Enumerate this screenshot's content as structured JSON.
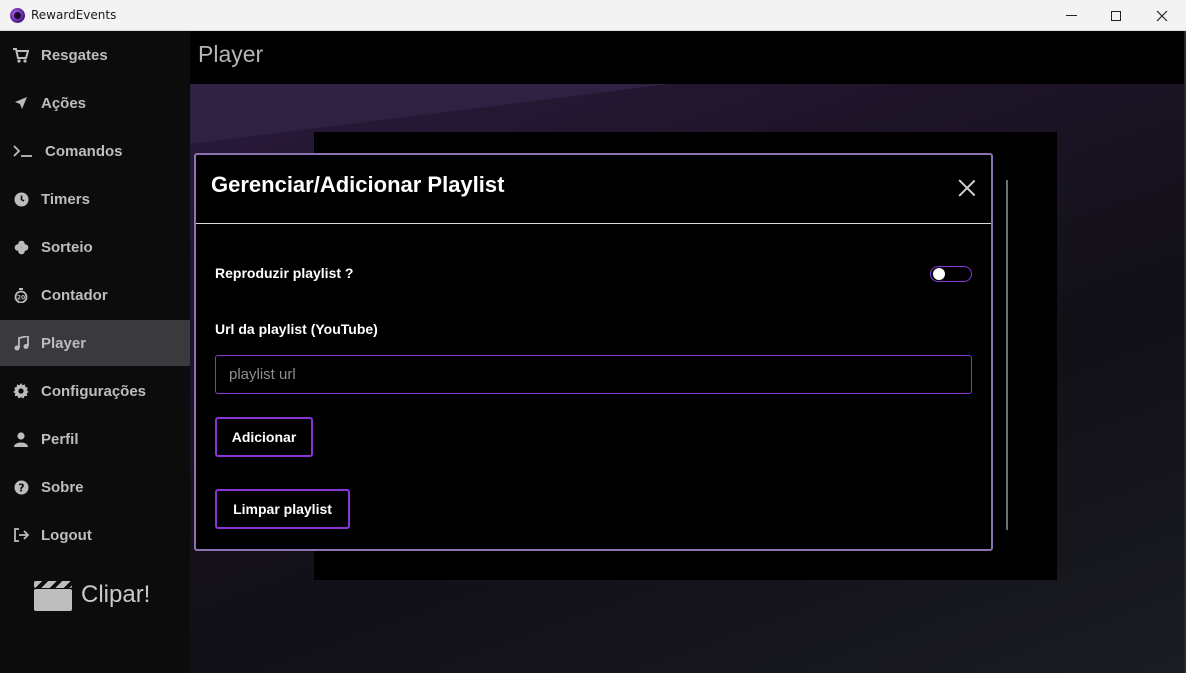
{
  "window": {
    "title": "RewardEvents",
    "controls": {
      "minimize": "minimize-icon",
      "maximize": "maximize-icon",
      "close": "close-icon"
    }
  },
  "sidebar": {
    "items": [
      {
        "label": "Resgates",
        "icon": "cart-icon"
      },
      {
        "label": "Ações",
        "icon": "location-arrow-icon"
      },
      {
        "label": "Comandos",
        "icon": "terminal-icon"
      },
      {
        "label": "Timers",
        "icon": "clock-icon"
      },
      {
        "label": "Sorteio",
        "icon": "clover-icon"
      },
      {
        "label": "Contador",
        "icon": "stopwatch-icon"
      },
      {
        "label": "Player",
        "icon": "music-note-icon",
        "active": true
      },
      {
        "label": "Configurações",
        "icon": "gear-icon"
      },
      {
        "label": "Perfil",
        "icon": "user-icon"
      },
      {
        "label": "Sobre",
        "icon": "question-icon"
      },
      {
        "label": "Logout",
        "icon": "logout-icon"
      }
    ],
    "clip_label": "Clipar!"
  },
  "main": {
    "page_title": "Player"
  },
  "modal": {
    "title": "Gerenciar/Adicionar Playlist",
    "play_label": "Reproduzir playlist ?",
    "play_enabled": false,
    "url_label": "Url da playlist (YouTube)",
    "url_placeholder": "playlist url",
    "url_value": "",
    "add_label": "Adicionar",
    "clear_label": "Limpar playlist"
  },
  "colors": {
    "accent": "#8a35d6",
    "modal_border": "#8a73b0",
    "sidebar_active": "#3a3a3e"
  }
}
